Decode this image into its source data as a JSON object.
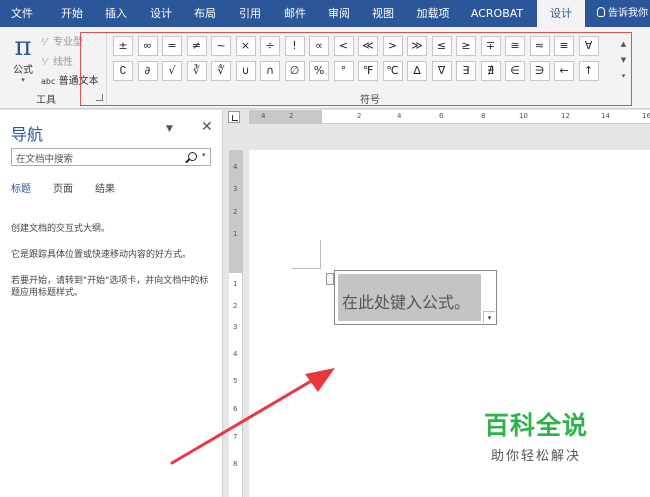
{
  "tabs": [
    "文件",
    "开始",
    "插入",
    "设计",
    "布局",
    "引用",
    "邮件",
    "审阅",
    "视图",
    "加载项",
    "ACROBAT",
    "设计"
  ],
  "tell_me": "告诉我你",
  "tools_group": {
    "equation_label": "公式",
    "professional": "专业型",
    "linear": "线性",
    "normal_text": "普通文本",
    "normal_text_prefix": "abc",
    "label": "工具"
  },
  "symbols_group": {
    "label": "符号",
    "row1": [
      "±",
      "∞",
      "=",
      "≠",
      "~",
      "×",
      "÷",
      "!",
      "∝",
      "<",
      "≪",
      ">",
      "≫",
      "≤",
      "≥",
      "∓",
      "≅",
      "≈",
      "≡",
      "∀"
    ],
    "row2": [
      "∁",
      "∂",
      "√",
      "∛",
      "∜",
      "∪",
      "∩",
      "∅",
      "%",
      "°",
      "℉",
      "℃",
      "∆",
      "∇",
      "∃",
      "∄",
      "∈",
      "∋",
      "←",
      "↑"
    ]
  },
  "nav": {
    "title": "导航",
    "search_placeholder": "在文档中搜索",
    "tabs": [
      "标题",
      "页面",
      "结果"
    ],
    "p1": "创建文档的交互式大纲。",
    "p2": "它是跟踪具体位置或快速移动内容的好方式。",
    "p3": "若要开始，请转到\"开始\"选项卡，并向文档中的标题应用标题样式。"
  },
  "ruler": {
    "h_labels": [
      "4",
      "2",
      "2",
      "4",
      "6",
      "8",
      "10",
      "12",
      "14",
      "16"
    ],
    "v_labels": [
      "4",
      "3",
      "2",
      "1",
      "1",
      "2",
      "3",
      "4",
      "5",
      "6",
      "7",
      "8"
    ]
  },
  "equation": {
    "placeholder": "在此处键入公式。"
  },
  "watermark": {
    "title": "百科全说",
    "subtitle": "助你轻松解决"
  },
  "colors": {
    "accent": "#2b579a",
    "highlight": "#e05050",
    "arrow": "#e8383d",
    "watermark": "#2db34a"
  }
}
